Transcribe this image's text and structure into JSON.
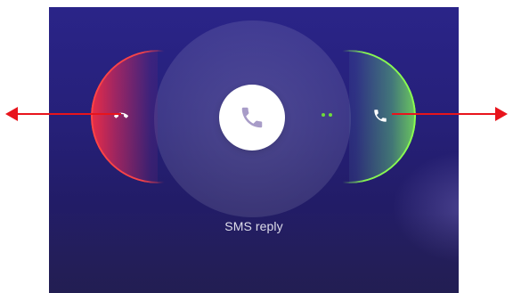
{
  "call_screen": {
    "background_color": "#262079",
    "answer_button": {
      "icon": "phone-icon",
      "icon_color": "#a89cc8"
    },
    "reject_action": {
      "icon": "phone-hangup-icon",
      "accent_color": "#eb2d46"
    },
    "accept_action": {
      "icon": "phone-icon",
      "accent_color": "#8cff50",
      "hint": "swipe-dots"
    },
    "sms_reply_label": "SMS reply"
  },
  "annotations": {
    "left_arrow": {
      "color": "#e8141c",
      "direction": "left"
    },
    "right_arrow": {
      "color": "#e8141c",
      "direction": "right"
    }
  }
}
